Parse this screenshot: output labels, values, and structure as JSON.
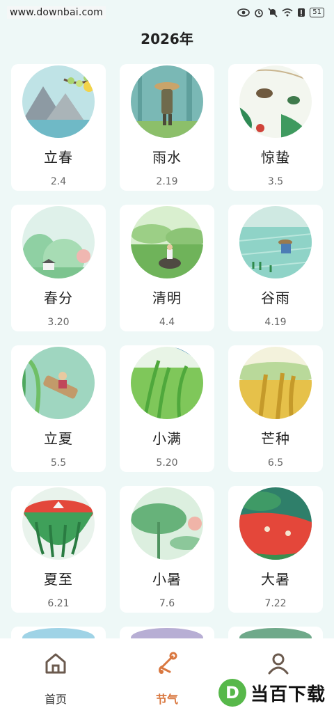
{
  "status_bar": {
    "watermark": "www.downbai.com",
    "battery": "51",
    "icons": [
      "eye-icon",
      "alarm-icon",
      "mute-icon",
      "wifi-icon",
      "alert-icon",
      "battery-icon"
    ]
  },
  "header": {
    "title": "2026年"
  },
  "terms": [
    {
      "name": "立春",
      "date": "2.4",
      "scene": "mountain-plum"
    },
    {
      "name": "雨水",
      "date": "2.19",
      "scene": "farmer-rain"
    },
    {
      "name": "惊蛰",
      "date": "3.5",
      "scene": "insects"
    },
    {
      "name": "春分",
      "date": "3.20",
      "scene": "spring-hills"
    },
    {
      "name": "清明",
      "date": "4.4",
      "scene": "ox-rider"
    },
    {
      "name": "谷雨",
      "date": "4.19",
      "scene": "rice-planting"
    },
    {
      "name": "立夏",
      "date": "5.5",
      "scene": "boat-river"
    },
    {
      "name": "小满",
      "date": "5.20",
      "scene": "wheat-field"
    },
    {
      "name": "芒种",
      "date": "6.5",
      "scene": "golden-grain"
    },
    {
      "name": "夏至",
      "date": "6.21",
      "scene": "watermelon"
    },
    {
      "name": "小暑",
      "date": "7.6",
      "scene": "lotus-leaf"
    },
    {
      "name": "大暑",
      "date": "7.22",
      "scene": "melon-swim"
    }
  ],
  "bottom_nav": {
    "items": [
      {
        "label": "首页",
        "icon": "home-icon",
        "active": false
      },
      {
        "label": "节气",
        "icon": "solar-term-icon",
        "active": true
      },
      {
        "label": "",
        "icon": "profile-icon",
        "active": false
      }
    ]
  },
  "watermark_bottom": {
    "logo": "D",
    "text": "当百下载"
  },
  "colors": {
    "accent": "#d9773f",
    "background": "#eef8f7"
  }
}
